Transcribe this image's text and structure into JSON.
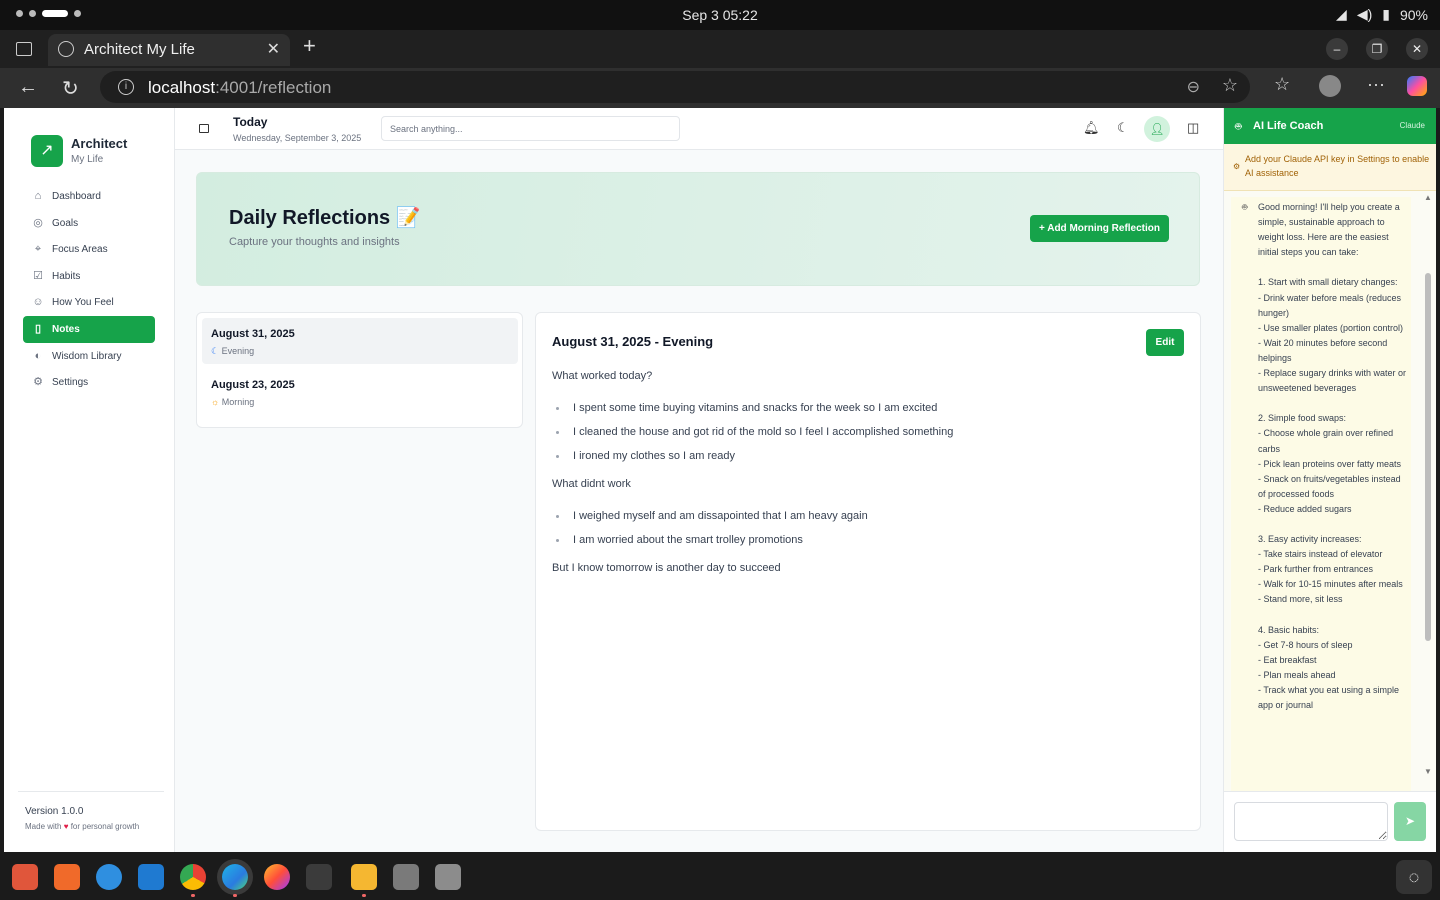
{
  "os": {
    "clock": "Sep 3  05:22",
    "battery": "90%",
    "wifi_icon": "wifi-icon",
    "volume_icon": "volume-icon",
    "battery_icon": "battery-icon"
  },
  "browser": {
    "tab_title": "Architect My Life",
    "url_host": "localhost",
    "url_rest": ":4001/reflection"
  },
  "sidebar": {
    "brand": "Architect",
    "brand_sub": "My Life",
    "items": [
      {
        "label": "Dashboard",
        "icon": "⌂"
      },
      {
        "label": "Goals",
        "icon": "◎"
      },
      {
        "label": "Focus Areas",
        "icon": "⌖"
      },
      {
        "label": "Habits",
        "icon": "☑"
      },
      {
        "label": "How You Feel",
        "icon": "☺"
      },
      {
        "label": "Notes",
        "icon": "▯"
      },
      {
        "label": "Wisdom Library",
        "icon": "◐"
      },
      {
        "label": "Settings",
        "icon": "⚙"
      }
    ],
    "active_index": 5,
    "version": "Version 1.0.0",
    "made_prefix": "Made with",
    "made_heart": "♥",
    "made_suffix": "for personal growth"
  },
  "header": {
    "today": "Today",
    "date": "Wednesday, September 3, 2025",
    "search_placeholder": "Search anything..."
  },
  "hero": {
    "title": "Daily Reflections 📝",
    "subtitle": "Capture your thoughts and insights",
    "add_button": "+  Add Morning Reflection"
  },
  "entries": [
    {
      "date": "August 31, 2025",
      "type": "Evening",
      "icon": "☾"
    },
    {
      "date": "August 23, 2025",
      "type": "Morning",
      "icon": "☼"
    }
  ],
  "detail": {
    "title": "August 31, 2025 - Evening",
    "edit": "Edit",
    "q1": "What worked today?",
    "worked": [
      "I spent some time buying vitamins and snacks for the week so I am excited",
      "I cleaned the house and got rid of the mold so I feel I accomplished something",
      "I ironed my clothes so I am ready"
    ],
    "q2": "What didnt work",
    "didnt": [
      "I weighed myself and am dissapointed that I am heavy again",
      "I am worried about the smart trolley promotions"
    ],
    "closing": "But I know tomorrow is another day to succeed"
  },
  "coach": {
    "title": "AI Life Coach",
    "tag": "Claude",
    "notice": "Add your Claude API key in Settings to enable AI assistance",
    "message": "Good morning! I'll help you create a simple, sustainable approach to weight loss. Here are the easiest initial steps you can take:\n\n1. Start with small dietary changes:\n- Drink water before meals (reduces hunger)\n- Use smaller plates (portion control)\n- Wait 20 minutes before second helpings\n- Replace sugary drinks with water or unsweetened beverages\n\n2. Simple food swaps:\n- Choose whole grain over refined carbs\n- Pick lean proteins over fatty meats\n- Snack on fruits/vegetables instead of processed foods\n- Reduce added sugars\n\n3. Easy activity increases:\n- Take stairs instead of elevator\n- Park further from entrances\n- Walk for 10-15 minutes after meals\n- Stand more, sit less\n\n4. Basic habits:\n- Get 7-8 hours of sleep\n- Eat breakfast\n- Plan meals ahead\n- Track what you eat using a simple app or journal",
    "send_icon": "➤"
  },
  "colors": {
    "accent": "#16a34a",
    "notice_bg": "#fdf6e0"
  }
}
